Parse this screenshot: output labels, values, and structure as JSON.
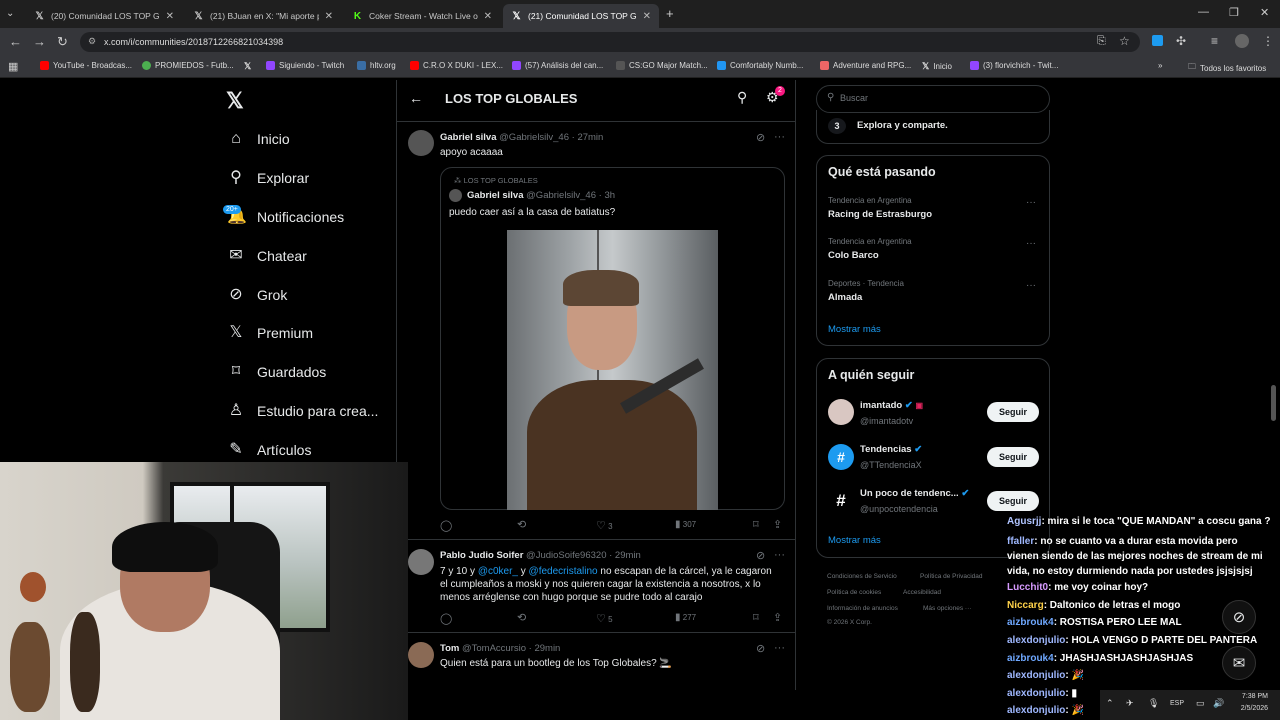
{
  "browser": {
    "tabs": [
      {
        "title": "(20) Comunidad LOS TOP GLOBALES",
        "icon": "x-logo-icon"
      },
      {
        "title": "(21) BJuan en X: \"Mi aporte para",
        "icon": "x-logo-icon"
      },
      {
        "title": "Coker Stream - Watch Live on Kick",
        "icon": "kick-icon"
      },
      {
        "title": "(21) Comunidad LOS TOP GLOBALES",
        "icon": "x-logo-icon"
      }
    ],
    "url": "x.com/i/communities/2018712266821034398",
    "bookmarks": [
      "YouTube - Broadcas...",
      "PROMIEDOS - Futb...",
      "",
      "Siguiendo - Twitch",
      "hltv.org",
      "C.R.O X DUKI - LEX...",
      "(57) Análisis del can...",
      "CS:GO Major Match...",
      "Comfortably Numb...",
      "Adventure and RPG...",
      "Inicio",
      "(3) florvichich - Twit..."
    ],
    "bookmarks_folder": "Todos los favoritos"
  },
  "nav": {
    "items": [
      "Inicio",
      "Explorar",
      "Notificaciones",
      "Chatear",
      "Grok",
      "Premium",
      "Guardados",
      "Estudio para crea...",
      "Artículos"
    ],
    "notif_badge": "20+"
  },
  "header": {
    "title": "LOS TOP GLOBALES",
    "settings_badge": "2"
  },
  "posts": [
    {
      "name": "Gabriel silva",
      "handle": "@Gabrielsilv_46 · 27min",
      "text": "apoyo acaaaa",
      "quote": {
        "community": "LOS TOP GLOBALES",
        "name": "Gabriel silva",
        "handle": "@Gabrielsilv_46 · 3h",
        "text": "puedo caer así a la casa de batiatus?"
      },
      "likes": "3",
      "views": "307"
    },
    {
      "name": "Pablo Judio Soifer",
      "handle": "@JudioSoife96320 · 29min",
      "text_parts": [
        "7 y 10 y ",
        "@c0ker_",
        "y ",
        "@fedecristalino",
        " no escapan de la cárcel, ya le cagaron el cumpleaños a moski y nos quieren cagar la existencia a nosotros, x lo menos arrégl​ense con hugo porque se pudre todo al carajo"
      ],
      "likes": "5",
      "views": "277"
    },
    {
      "name": "Tom",
      "handle": "@TomAccursio · 29min",
      "text": "Quien está para un bootleg de los Top Globales? 🚬"
    }
  ],
  "right": {
    "search_placeholder": "Buscar",
    "step_num": "3",
    "step_text": "Explora y comparte.",
    "trending_title": "Qué está pasando",
    "trends": [
      {
        "context": "Tendencia en Argentina",
        "name": "Racing de Estrasburgo"
      },
      {
        "context": "Tendencia en Argentina",
        "name": "Colo Barco"
      },
      {
        "context": "Deportes · Tendencia",
        "name": "Almada"
      }
    ],
    "show_more": "Mostrar más",
    "follow_title": "A quién seguir",
    "follow": [
      {
        "name": "imantado",
        "handle": "@imantadotv"
      },
      {
        "name": "Tendencias",
        "handle": "@TTendenciaX"
      },
      {
        "name": "Un poco de tendenc...",
        "handle": "@unpocotendencia"
      }
    ],
    "follow_btn": "Seguir",
    "footer": [
      "Condiciones de Servicio",
      "Política de Privacidad",
      "Política de cookies",
      "Accesibilidad",
      "Información de anuncios",
      "Más opciones ···",
      "© 2026 X Corp."
    ]
  },
  "chat": [
    {
      "user": "Agusrjj",
      "color": "#b0c4ff",
      "msg": ": mira si le toca \"QUE MANDAN\" a coscu gana ?"
    },
    {
      "user": "ffaller",
      "color": "#9fb8ff",
      "msg": ": no se cuanto va a durar esta movida pero vienen siendo de las mejores noches de stream de mi vida, no estoy durmiendo nada por ustedes jsjsjsjsj"
    },
    {
      "user": "Lucchit0",
      "color": "#d79bff",
      "msg": ": me voy coinar hoy?"
    },
    {
      "user": "Niccarg",
      "color": "#ffd24a",
      "msg": ": Daltonico de letras el mogo"
    },
    {
      "user": "aizbrouk4",
      "color": "#6fa8ff",
      "msg": ": ROSTISA PERO LEE MAL"
    },
    {
      "user": "alexdonjulio",
      "color": "#9fb8ff",
      "msg": ": HOLA VENGO D PARTE DEL PANTERA"
    },
    {
      "user": "aizbrouk4",
      "color": "#6fa8ff",
      "msg": ": JHASHJASHJASHJASHJAS"
    },
    {
      "user": "alexdonjulio",
      "color": "#9fb8ff",
      "msg": ": 🎉"
    },
    {
      "user": "alexdonjulio",
      "color": "#9fb8ff",
      "msg": ": ▮"
    },
    {
      "user": "alexdonjulio",
      "color": "#9fb8ff",
      "msg": ": 🎉"
    }
  ],
  "taskbar": {
    "lang": "ESP",
    "time": "7:38 PM",
    "date": "2/5/2026"
  }
}
